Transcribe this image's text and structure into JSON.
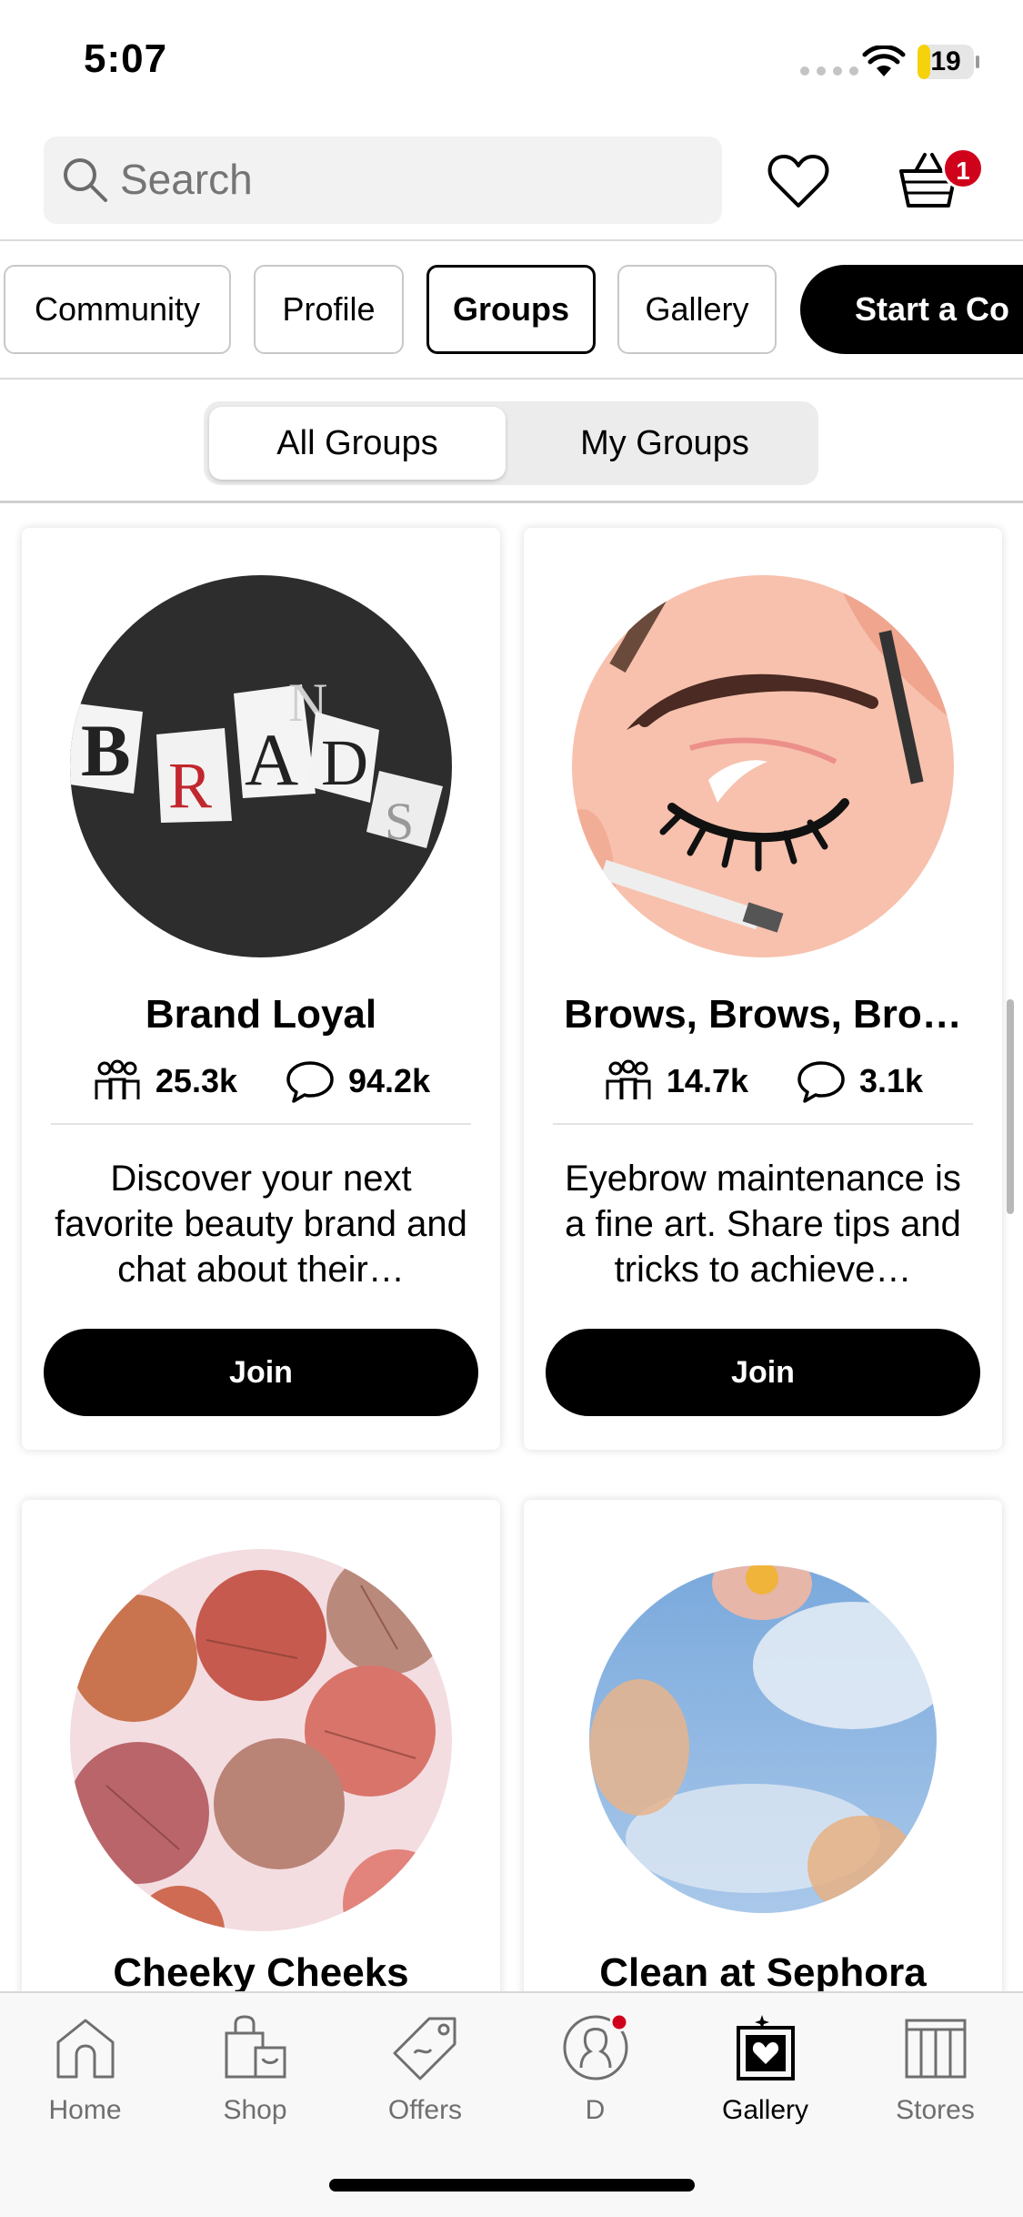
{
  "status_bar": {
    "time": "5:07",
    "battery": "19"
  },
  "header": {
    "search_placeholder": "Search",
    "cart_count": "1"
  },
  "tabs": [
    {
      "label": "Community",
      "active": false
    },
    {
      "label": "Profile",
      "active": false
    },
    {
      "label": "Groups",
      "active": true
    },
    {
      "label": "Gallery",
      "active": false
    }
  ],
  "start_button": "Start a Co",
  "segments": {
    "all_groups": "All Groups",
    "my_groups": "My Groups",
    "selected": "All Groups"
  },
  "groups": [
    {
      "title": "Brand Loyal",
      "members": "25.3k",
      "comments": "94.2k",
      "description": "Discover your next favorite beauty brand and chat about their…",
      "join": "Join",
      "image_text": "BRANDS"
    },
    {
      "title": "Brows, Brows, Bro…",
      "members": "14.7k",
      "comments": "3.1k",
      "description": "Eyebrow maintenance is a fine art. Share tips and tricks to achieve…",
      "join": "Join"
    },
    {
      "title": "Cheeky Cheeks"
    },
    {
      "title": "Clean at Sephora"
    }
  ],
  "bottom_nav": [
    {
      "label": "Home",
      "icon": "home-icon",
      "active": false
    },
    {
      "label": "Shop",
      "icon": "shop-bag-icon",
      "active": false
    },
    {
      "label": "Offers",
      "icon": "tag-icon",
      "active": false
    },
    {
      "label": "D",
      "icon": "profile-icon",
      "active": false
    },
    {
      "label": "Gallery",
      "icon": "gallery-icon",
      "active": true
    },
    {
      "label": "Stores",
      "icon": "store-icon",
      "active": false
    }
  ],
  "colors": {
    "badge": "#d0021b",
    "button": "#000000"
  }
}
